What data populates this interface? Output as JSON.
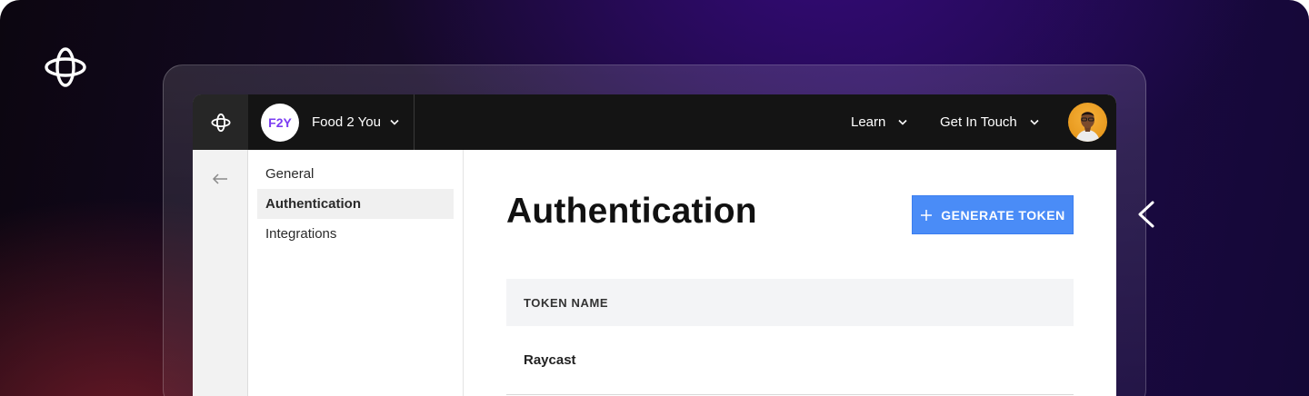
{
  "topbar": {
    "org": {
      "initials": "F2Y",
      "name": "Food 2 You"
    },
    "nav": [
      {
        "label": "Learn"
      },
      {
        "label": "Get In Touch"
      }
    ]
  },
  "subnav": {
    "items": [
      {
        "label": "General",
        "active": false
      },
      {
        "label": "Authentication",
        "active": true
      },
      {
        "label": "Integrations",
        "active": false
      }
    ]
  },
  "main": {
    "title": "Authentication",
    "generate_button": "GENERATE TOKEN",
    "table": {
      "columns": [
        "TOKEN NAME"
      ],
      "rows": [
        [
          "Raycast"
        ]
      ]
    }
  },
  "icons": {
    "brand": "flower-logo-icon",
    "back": "back-arrow-icon",
    "chevron": "chevron-down-icon",
    "plus": "plus-icon",
    "pointer": "left-arrow-icon"
  },
  "colors": {
    "accent": "#4a8cf7",
    "topbar": "#141414",
    "org_initials": "#7b3cf2",
    "avatar_bg": "#f0a42a"
  }
}
